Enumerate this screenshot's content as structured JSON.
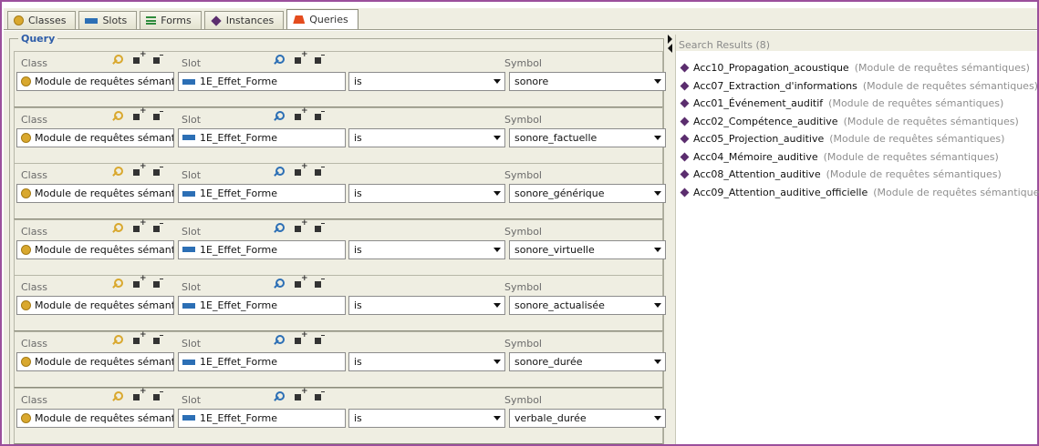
{
  "tabs": [
    {
      "label": "Classes",
      "icon": "class-icon"
    },
    {
      "label": "Slots",
      "icon": "slot-icon"
    },
    {
      "label": "Forms",
      "icon": "forms-icon"
    },
    {
      "label": "Instances",
      "icon": "instance-icon"
    },
    {
      "label": "Queries",
      "icon": "query-icon",
      "active": true
    }
  ],
  "query": {
    "title": "Query",
    "labels": {
      "class": "Class",
      "slot": "Slot",
      "symbol": "Symbol"
    },
    "ellipsis": "...",
    "rows": [
      {
        "class": "Module de requêtes sémantic",
        "slot": "1E_Effet_Forme",
        "operator": "is",
        "symbol": "sonore"
      },
      {
        "class": "Module de requêtes sémantic",
        "slot": "1E_Effet_Forme",
        "operator": "is",
        "symbol": "sonore_factuelle"
      },
      {
        "class": "Module de requêtes sémantic",
        "slot": "1E_Effet_Forme",
        "operator": "is",
        "symbol": "sonore_générique"
      },
      {
        "class": "Module de requêtes sémantic",
        "slot": "1E_Effet_Forme",
        "operator": "is",
        "symbol": "sonore_virtuelle"
      },
      {
        "class": "Module de requêtes sémantic",
        "slot": "1E_Effet_Forme",
        "operator": "is",
        "symbol": "sonore_actualisée"
      },
      {
        "class": "Module de requêtes sémantic",
        "slot": "1E_Effet_Forme",
        "operator": "is",
        "symbol": "sonore_durée"
      },
      {
        "class": "Module de requêtes sémantic",
        "slot": "1E_Effet_Forme",
        "operator": "is",
        "symbol": "verbale_durée"
      }
    ]
  },
  "results": {
    "title": "Search Results (8)",
    "items": [
      {
        "name": "Acc10_Propagation_acoustique",
        "module": "(Module de requêtes sémantiques)"
      },
      {
        "name": "Acc07_Extraction_d'informations",
        "module": "(Module de requêtes sémantiques)"
      },
      {
        "name": "Acc01_Événement_auditif",
        "module": "(Module de requêtes sémantiques)"
      },
      {
        "name": "Acc02_Compétence_auditive",
        "module": "(Module de requêtes sémantiques)"
      },
      {
        "name": "Acc05_Projection_auditive",
        "module": "(Module de requêtes sémantiques)"
      },
      {
        "name": "Acc04_Mémoire_auditive",
        "module": "(Module de requêtes sémantiques)"
      },
      {
        "name": "Acc08_Attention_auditive",
        "module": "(Module de requêtes sémantiques)"
      },
      {
        "name": "Acc09_Attention_auditive_officielle",
        "module": "(Module de requêtes sémantiques)"
      }
    ]
  },
  "colors": {
    "frame_border": "#9b4f9c",
    "panel_bg": "#efeee2",
    "query_title": "#2d5ca8",
    "class_icon": "#d9a82e",
    "slot_icon": "#2c6fb5",
    "instance_icon": "#5b2d6e",
    "query_icon": "#e44c1e"
  }
}
